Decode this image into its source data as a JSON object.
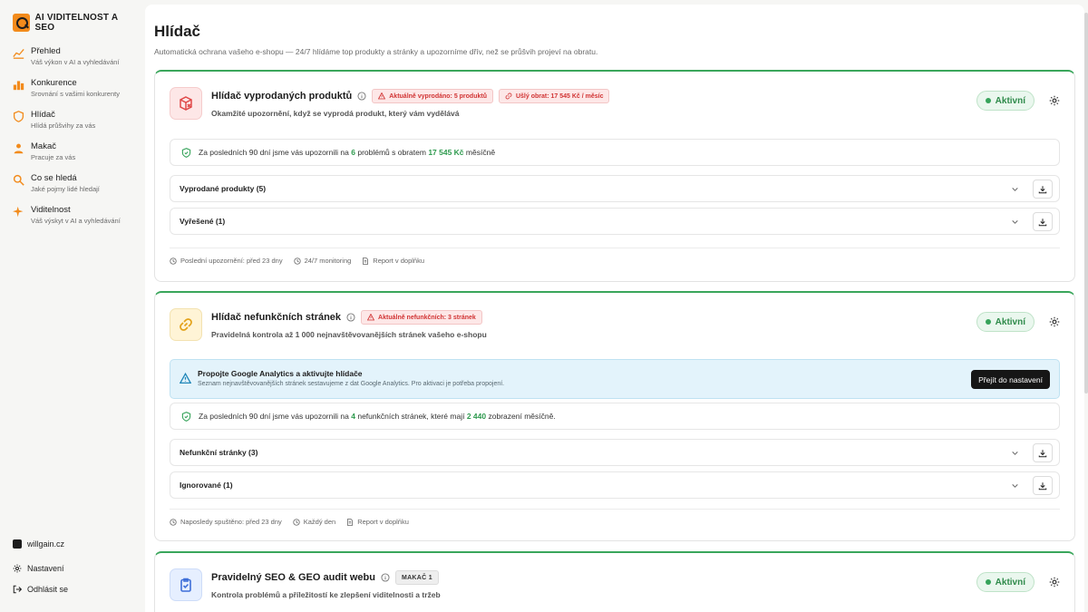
{
  "sidebar": {
    "logo": "AI VIDITELNOST A SEO",
    "items": [
      {
        "label": "Přehled",
        "sub": "Váš výkon v AI a vyhledávání",
        "icon": "chart-line-icon"
      },
      {
        "label": "Konkurence",
        "sub": "Srovnání s vašimi konkurenty",
        "icon": "bar-chart-icon"
      },
      {
        "label": "Hlídač",
        "sub": "Hlídá průšvihy za vás",
        "icon": "shield-icon"
      },
      {
        "label": "Makač",
        "sub": "Pracuje za vás",
        "icon": "worker-icon"
      },
      {
        "label": "Co se hledá",
        "sub": "Jaké pojmy lidé hledají",
        "icon": "search-icon"
      },
      {
        "label": "Viditelnost",
        "sub": "Váš výskyt v AI a vyhledávání",
        "icon": "sparkle-icon"
      }
    ],
    "brand": "willgain.cz",
    "settings": "Nastavení",
    "logout": "Odhlásit se"
  },
  "page": {
    "title": "Hlídač",
    "subtitle": "Automatická ochrana vašeho e-shopu — 24/7 hlídáme top produkty a stránky a upozorníme dřív, než se průšvih projeví na obratu."
  },
  "cards": [
    {
      "title": "Hlídač vyprodaných produktů",
      "badge1": "Aktuálně vyprodáno: 5 produktů",
      "badge2": "Ušlý obrat: 17 545 Kč / měsíc",
      "desc": "Okamžité upozornění, když se vyprodá produkt, který vám vydělává",
      "status": "Aktivní",
      "summary_pre": "Za posledních 90 dní jsme vás upozornili na",
      "summary_num1": "6",
      "summary_mid": "problémů s obratem",
      "summary_num2": "17 545 Kč",
      "summary_post": "měsíčně",
      "acc1": "Vyprodané produkty (5)",
      "acc2": "Vyřešené (1)",
      "f1": "Poslední upozornění: před 23 dny",
      "f2": "24/7 monitoring",
      "f3": "Report v doplňku"
    },
    {
      "title": "Hlídač nefunkčních stránek",
      "badge1": "Aktuálně nefunkčních: 3 stránek",
      "desc": "Pravidelná kontrola až 1 000 nejnavštěvovanějších stránek vašeho e-shopu",
      "status": "Aktivní",
      "alert_title": "Propojte Google Analytics a aktivujte hlídače",
      "alert_text": "Seznam nejnavštěvovanějších stránek sestavujeme z dat Google Analytics. Pro aktivaci je potřeba propojení.",
      "alert_btn": "Přejít do nastavení",
      "summary_pre": "Za posledních 90 dní jsme vás upozornili na",
      "summary_num1": "4",
      "summary_mid": "nefunkčních stránek, které mají",
      "summary_num2": "2 440",
      "summary_post": "zobrazení měsíčně.",
      "acc1": "Nefunkční stránky (3)",
      "acc2": "Ignorované (1)",
      "f1": "Naposledy spuštěno: před 23 dny",
      "f2": "Každý den",
      "f3": "Report v doplňku"
    },
    {
      "title": "Pravidelný SEO & GEO audit webu",
      "badge1": "MAKAČ 1",
      "desc": "Kontrola problémů a příležitostí ke zlepšení viditelnosti a tržeb",
      "status": "Aktivní"
    }
  ],
  "colors": {
    "accent": "#f28b1c",
    "active_green": "#36a35a",
    "alert_blue": "#1f86b8",
    "danger": "#d13434"
  }
}
